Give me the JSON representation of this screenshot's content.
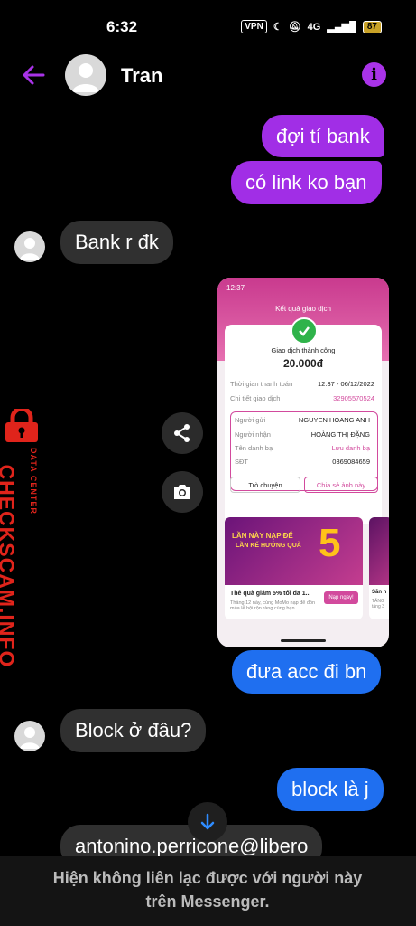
{
  "status_bar": {
    "time": "6:32",
    "vpn": "VPN",
    "network": "4G",
    "battery": "87"
  },
  "header": {
    "contact_name": "Tran"
  },
  "messages": [
    {
      "side": "out",
      "text": "đợi tí bank"
    },
    {
      "side": "out",
      "text": "có link ko bạn"
    },
    {
      "side": "in",
      "text": "Bank r đk"
    },
    {
      "side": "out",
      "text": "đưa acc đi bn"
    },
    {
      "side": "in",
      "text": "Block ở đâu?"
    },
    {
      "side": "out",
      "text": "block là j"
    },
    {
      "side": "in",
      "text": "antonino.perricone@libero"
    }
  ],
  "shared_image": {
    "time": "12:37",
    "screen_title": "Kết quả giao dịch",
    "status": "Giao dịch thành công",
    "amount": "20.000đ",
    "rows": [
      {
        "label": "Thời gian thanh toán",
        "value": "12:37 - 06/12/2022"
      },
      {
        "label": "Chi tiết giao dịch",
        "value": "32905570524"
      }
    ],
    "recipient": [
      {
        "label": "Người gửi",
        "value": "NGUYEN HOANG ANH"
      },
      {
        "label": "Người nhận",
        "value": "HOÀNG THỊ ĐẶNG"
      },
      {
        "label": "Tên danh bạ",
        "value": "Lưu danh bạ"
      },
      {
        "label": "SĐT",
        "value": "0369084659"
      }
    ],
    "buttons": {
      "chat": "Trò chuyện",
      "share": "Chia sẻ ảnh này"
    },
    "promo": {
      "headline": "LẦN NÀY NẠP ĐỂ",
      "subheadline": "LẦN KẾ HƯỞNG QUÀ",
      "big_number": "5",
      "title": "Thẻ quà giảm 5% tối đa 1...",
      "desc": "Tháng 12 này, cùng MoMo nạp để đón mùa lễ hội rộn ràng cùng bạn...",
      "cta": "Nạp ngay!"
    },
    "promo2": {
      "title": "Săn h",
      "desc": "TĂNG tặng 3"
    }
  },
  "watermark": {
    "brand": "CHECKSCAM.INFO",
    "tag": "DATA CENTER"
  },
  "footer": {
    "line1": "Hiện không liên lạc được với người này",
    "line2": "trên Messenger."
  },
  "colors": {
    "outgoing": "#a12ee6",
    "outgoing_blue": "#1f6ff0",
    "incoming": "#303030",
    "accent": "#a933e8"
  }
}
